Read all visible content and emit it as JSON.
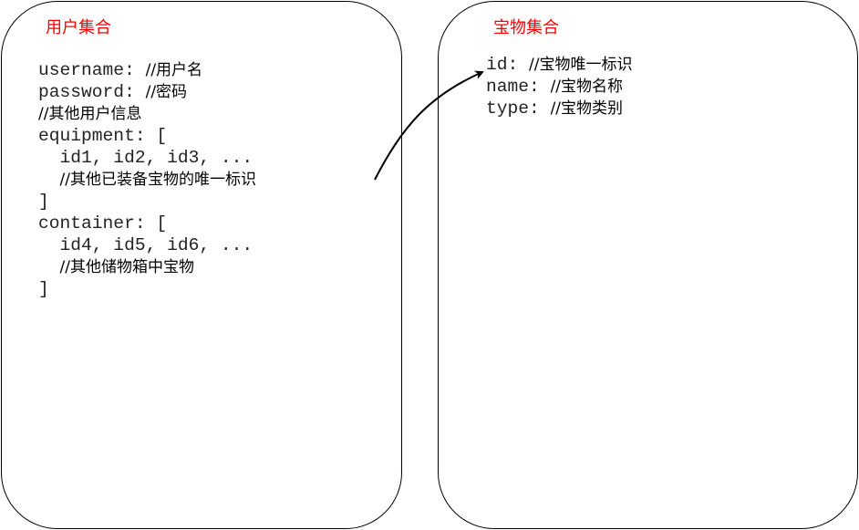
{
  "users_collection": {
    "title": "用户集合",
    "lines": [
      {
        "code": "username: ",
        "comment": "//用户名"
      },
      {
        "code": "password: ",
        "comment": "//密码"
      },
      {
        "code": "",
        "comment": "//其他用户信息"
      },
      {
        "code": "equipment: [",
        "comment": ""
      },
      {
        "code": "  id1, id2, id3, ...",
        "comment": ""
      },
      {
        "code": "  ",
        "comment": "//其他已装备宝物的唯一标识"
      },
      {
        "code": "]",
        "comment": ""
      },
      {
        "code": "container: [",
        "comment": ""
      },
      {
        "code": "  id4, id5, id6, ...",
        "comment": ""
      },
      {
        "code": "  ",
        "comment": "//其他储物箱中宝物"
      },
      {
        "code": "]",
        "comment": ""
      }
    ]
  },
  "items_collection": {
    "title": "宝物集合",
    "lines": [
      {
        "code": "id: ",
        "comment": "//宝物唯一标识"
      },
      {
        "code": "name: ",
        "comment": "//宝物名称"
      },
      {
        "code": "type: ",
        "comment": "//宝物类别"
      }
    ]
  },
  "colors": {
    "title": "#ff0000",
    "stroke": "#000000"
  }
}
